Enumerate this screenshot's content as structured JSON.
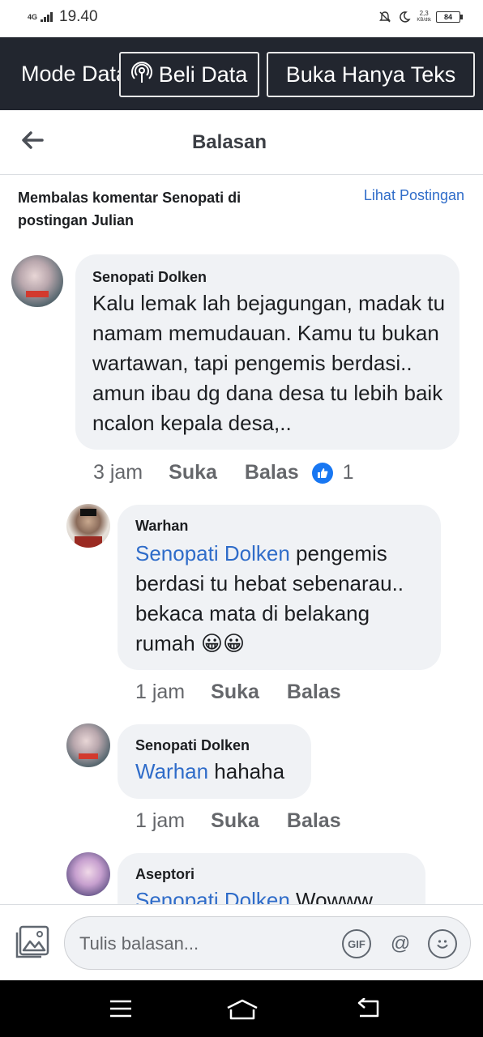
{
  "status_bar": {
    "network": "4G",
    "time": "19.40",
    "speed_value": "2,3",
    "speed_unit": "KB/dtk",
    "battery": "84"
  },
  "data_bar": {
    "mode_text": "Mode Data",
    "buy_label": "Beli Data",
    "text_only_label": "Buka Hanya Teks"
  },
  "header": {
    "title": "Balasan"
  },
  "context": {
    "text": "Membalas komentar Senopati di postingan Julian",
    "view_post": "Lihat Postingan"
  },
  "comments": [
    {
      "author": "Senopati Dolken",
      "text": "Kalu lemak lah bejagungan, madak tu namam memudauan. Kamu tu bukan wartawan, tapi pengemis berdasi.. amun ibau dg dana desa tu lebih baik ncalon kepala desa,..",
      "time": "3 jam",
      "like": "Suka",
      "reply": "Balas",
      "reactions": "1"
    },
    {
      "author": "Warhan",
      "mention": "Senopati Dolken",
      "text": " pengemis berdasi tu hebat sebenarau.. bekaca mata di belakang rumah 😀😀",
      "time": "1 jam",
      "like": "Suka",
      "reply": "Balas"
    },
    {
      "author": "Senopati Dolken",
      "mention": "Warhan",
      "text": " hahaha",
      "time": "1 jam",
      "like": "Suka",
      "reply": "Balas"
    },
    {
      "author": "Aseptori",
      "mention": "Senopati Dolken",
      "text": " Wowww"
    }
  ],
  "composer": {
    "placeholder": "Tulis balasan...",
    "gif": "GIF",
    "mention_symbol": "@"
  },
  "colors": {
    "accent": "#2f6cc9",
    "like_blue": "#1877f2",
    "bubble": "#f0f2f5",
    "databar": "#22262f"
  }
}
